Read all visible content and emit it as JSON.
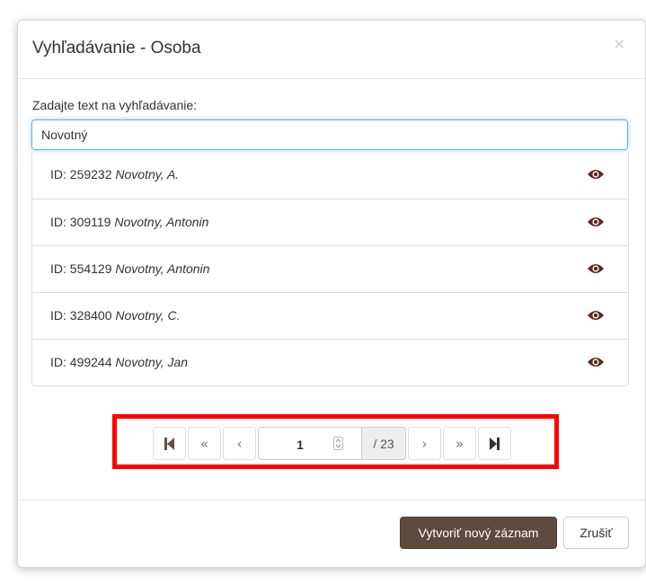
{
  "dialog": {
    "title": "Vyhľadávanie - Osoba",
    "close_label": "×"
  },
  "search": {
    "label": "Zadajte text na vyhľadávanie:",
    "value": "Novotný"
  },
  "results": [
    {
      "id_label": "ID: 259232",
      "name": "Novotny, A."
    },
    {
      "id_label": "ID: 309119",
      "name": "Novotny, Antonin"
    },
    {
      "id_label": "ID: 554129",
      "name": "Novotny, Antonin"
    },
    {
      "id_label": "ID: 328400",
      "name": "Novotny, C."
    },
    {
      "id_label": "ID: 499244",
      "name": "Novotny, Jan"
    }
  ],
  "pager": {
    "first_icon": "first-page-icon",
    "prev_block_label": "«",
    "prev_label": "‹",
    "current_page": "1",
    "total_label": "/ 23",
    "next_label": "›",
    "next_block_label": "»",
    "last_icon": "last-page-icon"
  },
  "footer": {
    "create_label": "Vytvoriť nový záznam",
    "cancel_label": "Zrušiť"
  },
  "colors": {
    "accent": "#5e4b3e",
    "eye_icon": "#5a2a1c",
    "highlight": "#ff0000",
    "focus_border": "#66afe9"
  }
}
